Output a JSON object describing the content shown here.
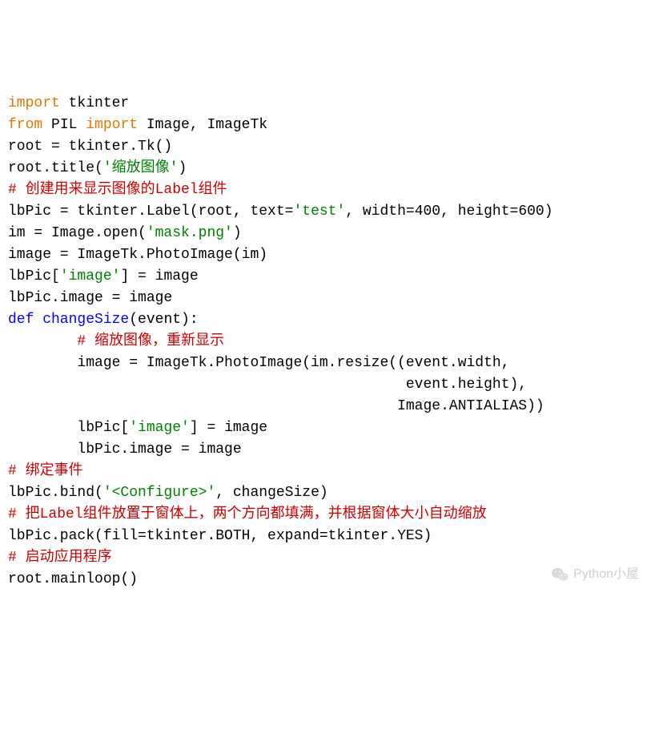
{
  "code": {
    "l1": {
      "kw1": "import",
      "t1": " tkinter"
    },
    "l2": {
      "kw1": "from",
      "t1": " PIL ",
      "kw2": "import",
      "t2": " Image, ImageTk"
    },
    "l3": "",
    "l4": "root = tkinter.Tk()",
    "l5": {
      "t1": "root.title(",
      "s1": "'缩放图像'",
      "t2": ")"
    },
    "l6": "",
    "l7": "# 创建用来显示图像的Label组件",
    "l8": {
      "t1": "lbPic = tkinter.Label(root, text=",
      "s1": "'test'",
      "t2": ", width=400, height=600)"
    },
    "l9": {
      "t1": "im = Image.open(",
      "s1": "'mask.png'",
      "t2": ")"
    },
    "l10": "image = ImageTk.PhotoImage(im)",
    "l11": {
      "t1": "lbPic[",
      "s1": "'image'",
      "t2": "] = image"
    },
    "l12": "lbPic.image = image",
    "l13": "",
    "l14": {
      "kw1": "def",
      "fn": " changeSize",
      "t1": "(event):"
    },
    "l15": "        # 缩放图像，重新显示",
    "l16": "        image = ImageTk.PhotoImage(im.resize((event.width,",
    "l17": "                                              event.height),",
    "l18": "                                             Image.ANTIALIAS))",
    "l19": {
      "t1": "        lbPic[",
      "s1": "'image'",
      "t2": "] = image"
    },
    "l20": "        lbPic.image = image",
    "l21": "# 绑定事件",
    "l22": {
      "t1": "lbPic.bind(",
      "s1": "'<Configure>'",
      "t2": ", changeSize)"
    },
    "l23": "# 把Label组件放置于窗体上，两个方向都填满，并根据窗体大小自动缩放",
    "l24": "lbPic.pack(fill=tkinter.BOTH, expand=tkinter.YES)",
    "l25": "",
    "l26": "# 启动应用程序",
    "l27": "root.mainloop()"
  },
  "watermark": {
    "text": "Python小屋"
  }
}
